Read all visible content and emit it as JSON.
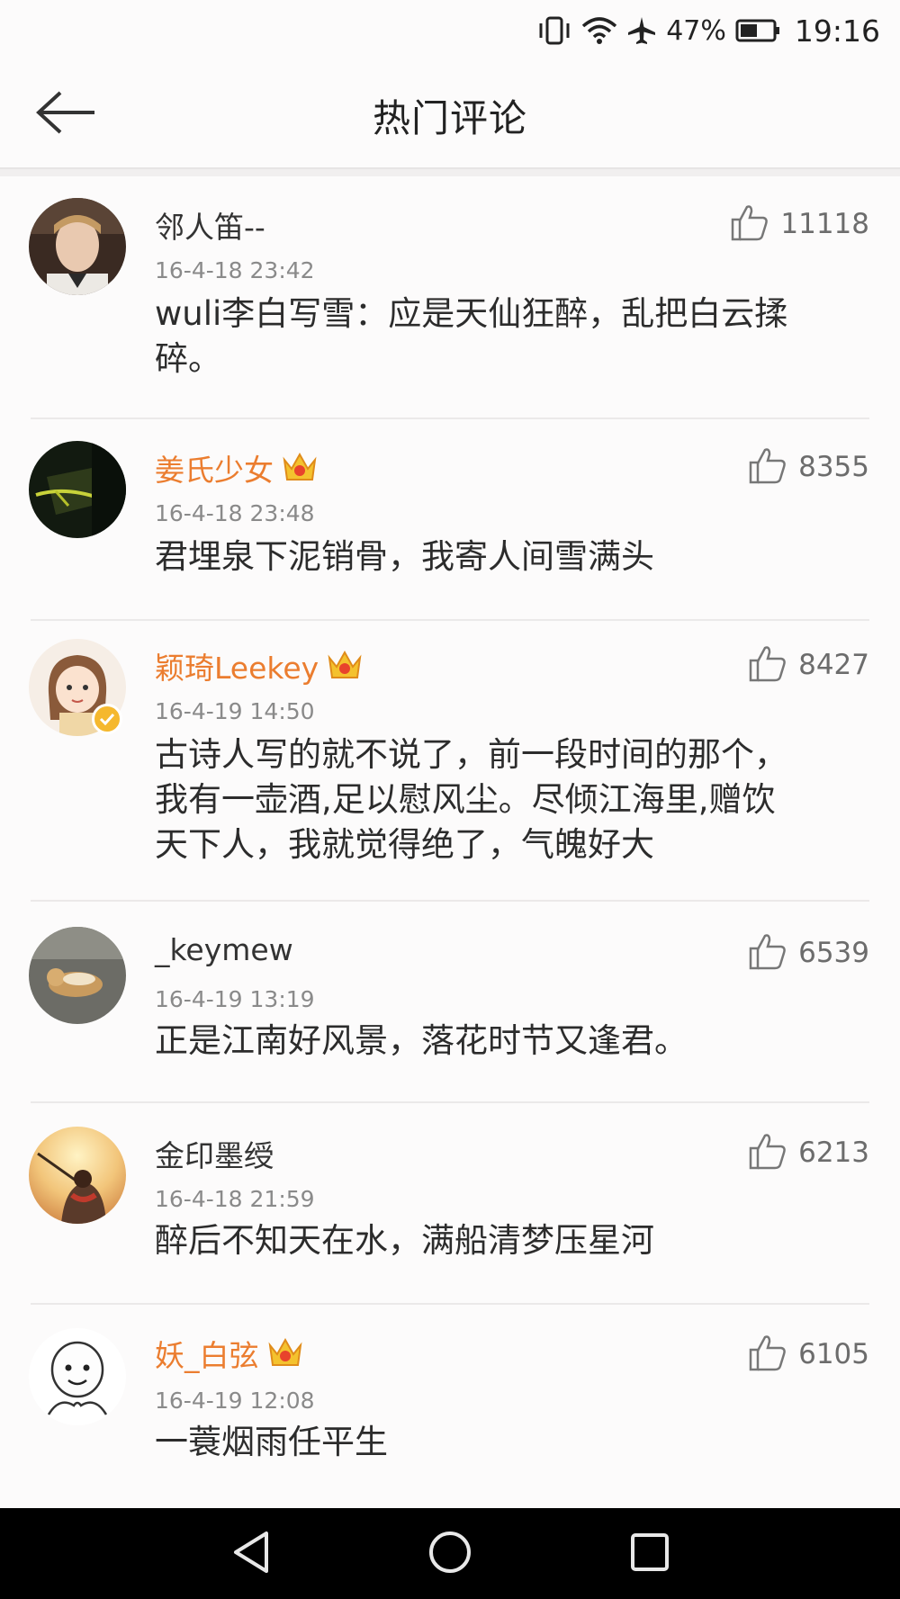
{
  "status_bar": {
    "battery_percent": "47%",
    "time": "19:16",
    "icons": [
      "vibrate-icon",
      "wifi-icon",
      "airplane-icon",
      "battery-icon"
    ]
  },
  "header": {
    "title": "热门评论",
    "back_icon": "arrow-left-icon"
  },
  "colors": {
    "vip_name": "#eb7d2f",
    "text": "#2c2c2c",
    "meta": "#8a8a8a",
    "verified_badge": "#f5b82e"
  },
  "comments": [
    {
      "username": "邻人笛--",
      "vip": false,
      "verified": false,
      "timestamp": "16-4-18 23:42",
      "likes": "11118",
      "lines": [
        "wuli李白写雪：应是天仙狂醉，乱把白云揉",
        "碎。"
      ]
    },
    {
      "username": "姜氏少女",
      "vip": true,
      "verified": false,
      "timestamp": "16-4-18 23:48",
      "likes": "8355",
      "lines": [
        "君埋泉下泥销骨，我寄人间雪满头"
      ]
    },
    {
      "username": "颖琦Leekey",
      "vip": true,
      "verified": true,
      "timestamp": "16-4-19 14:50",
      "likes": "8427",
      "lines": [
        "古诗人写的就不说了，前一段时间的那个，",
        "我有一壶酒,足以慰风尘。尽倾江海里,赠饮",
        "天下人，我就觉得绝了，气魄好大"
      ]
    },
    {
      "username": "_keymew",
      "vip": false,
      "verified": false,
      "timestamp": "16-4-19 13:19",
      "likes": "6539",
      "lines": [
        "正是江南好风景，落花时节又逢君。"
      ]
    },
    {
      "username": "金印墨绶",
      "vip": false,
      "verified": false,
      "timestamp": "16-4-18 21:59",
      "likes": "6213",
      "lines": [
        "醉后不知天在水，满船清梦压星河"
      ]
    },
    {
      "username": "妖_白弦",
      "vip": true,
      "verified": false,
      "timestamp": "16-4-19 12:08",
      "likes": "6105",
      "lines": [
        "一蓑烟雨任平生"
      ]
    }
  ],
  "nav_bar": {
    "buttons": [
      "back-triangle-icon",
      "home-circle-icon",
      "recents-square-icon"
    ]
  }
}
